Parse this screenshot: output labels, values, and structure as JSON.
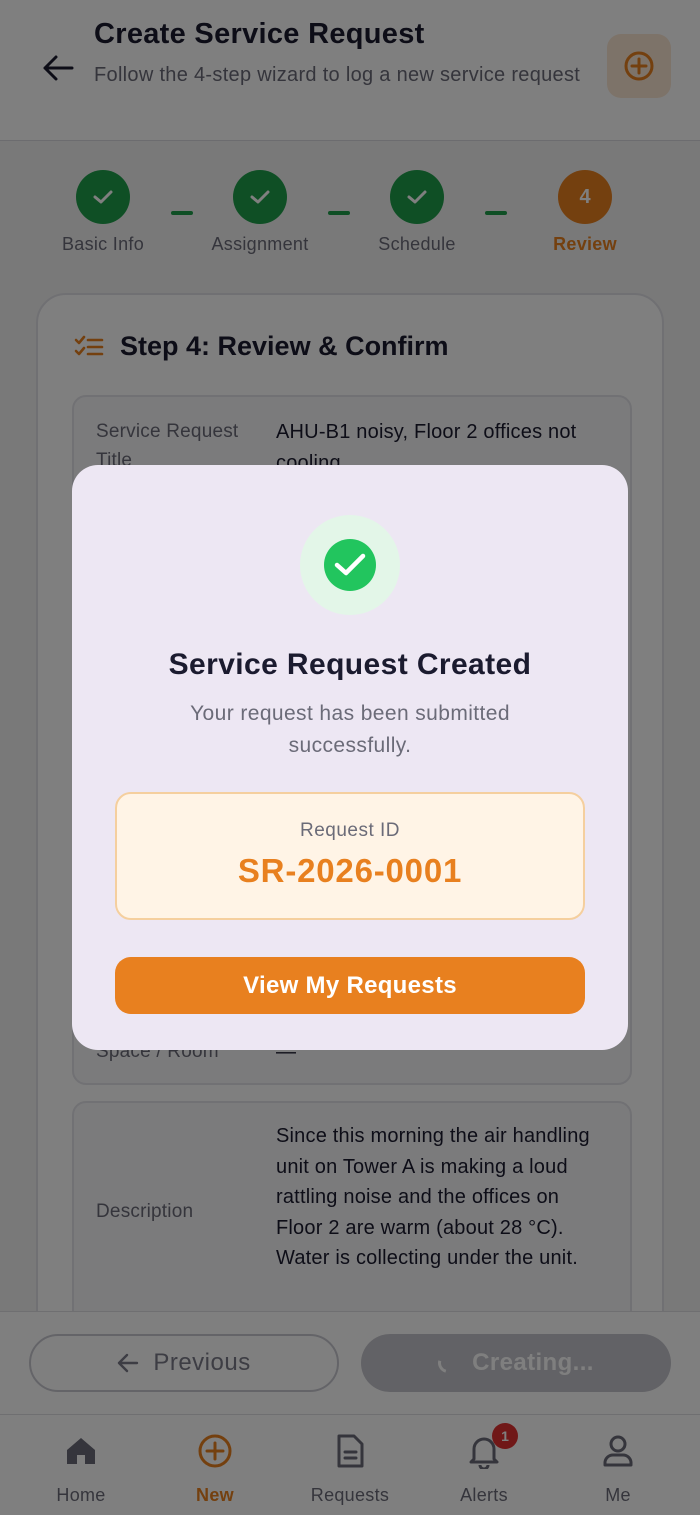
{
  "header": {
    "title": "Create Service Request",
    "subtitle": "Follow the 4-step wizard to log a new service request"
  },
  "stepper": {
    "steps": [
      {
        "label": "Basic Info",
        "status": "done"
      },
      {
        "label": "Assignment",
        "status": "done"
      },
      {
        "label": "Schedule",
        "status": "done"
      },
      {
        "label": "Review",
        "status": "active",
        "number": "4"
      }
    ]
  },
  "review": {
    "heading": "Step 4: Review & Confirm",
    "rows": [
      {
        "key": "Service Request Title",
        "value": "AHU-B1 noisy, Floor 2 offices not cooling"
      },
      {
        "key": "Space / Room",
        "value": "—"
      },
      {
        "key": "Description",
        "value": "Since this morning the air handling unit on Tower A is making a loud rattling noise and the offices on Floor 2 are warm (about 28 °C). Water is collecting under the unit."
      }
    ]
  },
  "actions": {
    "previous_label": "Previous",
    "create_label": "Creating..."
  },
  "tabs": [
    {
      "label": "Home",
      "icon": "home-icon"
    },
    {
      "label": "New",
      "icon": "plus-circle-icon",
      "active": true
    },
    {
      "label": "Requests",
      "icon": "document-icon"
    },
    {
      "label": "Alerts",
      "icon": "bell-icon",
      "badge": "1"
    },
    {
      "label": "Me",
      "icon": "user-icon"
    }
  ],
  "modal": {
    "title": "Service Request Created",
    "message": "Your request has been submitted successfully.",
    "id_label": "Request ID",
    "id_value": "SR-2026-0001",
    "button_label": "View My Requests"
  },
  "colors": {
    "accent": "#e8801f",
    "success": "#1e9e4a",
    "badge": "#e03131"
  }
}
